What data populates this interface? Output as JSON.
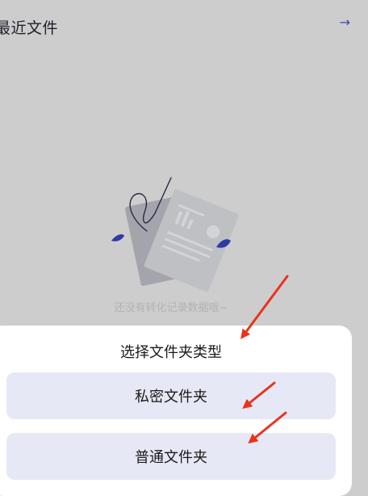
{
  "header": {
    "title": "最近文件",
    "arrow_glyph": "→"
  },
  "empty_state": {
    "message": "还没有转化记录数据哦~"
  },
  "folder_sheet": {
    "title": "选择文件夹类型",
    "options": [
      {
        "label": "私密文件夹"
      },
      {
        "label": "普通文件夹"
      }
    ]
  },
  "colors": {
    "backdrop": "#cdcdcd",
    "option_bg": "#e7e8f6",
    "accent": "#3b49b8",
    "annotation_arrow": "#e8341c"
  }
}
